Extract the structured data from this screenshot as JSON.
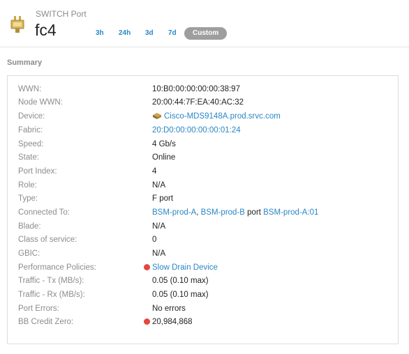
{
  "header": {
    "subtitle": "SWITCH Port",
    "title": "fc4",
    "ranges": [
      {
        "label": "3h",
        "active": false
      },
      {
        "label": "24h",
        "active": false
      },
      {
        "label": "3d",
        "active": false
      },
      {
        "label": "7d",
        "active": false
      },
      {
        "label": "Custom",
        "active": true
      }
    ]
  },
  "summary": {
    "title": "Summary",
    "rows": {
      "wwn": {
        "label": "WWN:",
        "value": "10:B0:00:00:00:00:38:97"
      },
      "node_wwn": {
        "label": "Node WWN:",
        "value": "20:00:44:7F:EA:40:AC:32"
      },
      "device": {
        "label": "Device:",
        "value": "Cisco-MDS9148A.prod.srvc.com",
        "icon": "device-icon"
      },
      "fabric": {
        "label": "Fabric:",
        "value": "20:D0:00:00:00:00:01:24"
      },
      "speed": {
        "label": "Speed:",
        "value": "4 Gb/s"
      },
      "state": {
        "label": "State:",
        "value": "Online"
      },
      "port_index": {
        "label": "Port Index:",
        "value": "4"
      },
      "role": {
        "label": "Role:",
        "value": "N/A"
      },
      "type": {
        "label": "Type:",
        "value": "F port"
      },
      "connected_to": {
        "label": "Connected To:",
        "link1": "BSM-prod-A",
        "sep": ", ",
        "link2": "BSM-prod-B",
        "port_word": " port ",
        "link3": "BSM-prod-A:01"
      },
      "blade": {
        "label": "Blade:",
        "value": "N/A"
      },
      "class_of_service": {
        "label": "Class of service:",
        "value": "0"
      },
      "gbic": {
        "label": "GBIC:",
        "value": "N/A"
      },
      "performance_policies": {
        "label": "Performance Policies:",
        "value": "Slow Drain Device"
      },
      "traffic_tx": {
        "label": "Traffic - Tx (MB/s):",
        "value": "0.05 (0.10 max)"
      },
      "traffic_rx": {
        "label": "Traffic - Rx (MB/s):",
        "value": "0.05 (0.10 max)"
      },
      "port_errors": {
        "label": "Port Errors:",
        "value": "No errors"
      },
      "bb_credit_zero": {
        "label": "BB Credit Zero:",
        "value": "20,984,868"
      }
    }
  },
  "colors": {
    "link": "#2a87c5",
    "alert": "#e4473c",
    "label": "#8c8c8c"
  }
}
